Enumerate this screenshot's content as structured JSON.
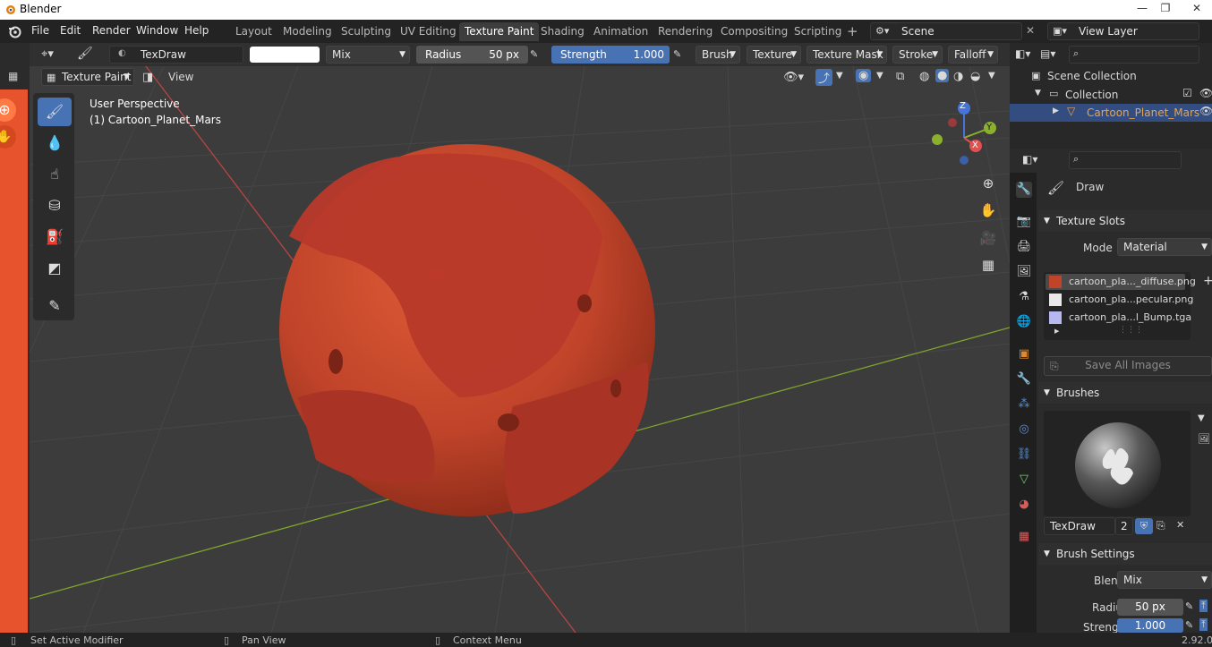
{
  "window": {
    "title": "Blender",
    "minimize": "—",
    "maximize": "❐",
    "close": "✕"
  },
  "menus": [
    "File",
    "Edit",
    "Render",
    "Window",
    "Help"
  ],
  "workspaces": [
    "Layout",
    "Modeling",
    "Sculpting",
    "UV Editing",
    "Texture Paint",
    "Shading",
    "Animation",
    "Rendering",
    "Compositing",
    "Scripting"
  ],
  "active_workspace": "Texture Paint",
  "add_workspace": "+",
  "scene": {
    "name": "Scene"
  },
  "view_layer": {
    "name": "View Layer"
  },
  "tool_header": {
    "brush_name": "TexDraw",
    "blend": "Mix",
    "radius_label": "Radius",
    "radius_value": "50 px",
    "strength_label": "Strength",
    "strength_value": "1.000",
    "strength_fraction": 1.0,
    "dropdowns": [
      "Brush",
      "Texture",
      "Texture Mask",
      "Stroke",
      "Falloff"
    ]
  },
  "viewport_header": {
    "mode": "Texture Paint",
    "view": "View"
  },
  "viewport": {
    "perspective": "User Perspective",
    "object": "(1) Cartoon_Planet_Mars",
    "gizmo_axes": {
      "z": "Z",
      "y": "Y",
      "x": "X"
    }
  },
  "outliner": {
    "scene_collection": "Scene Collection",
    "collection": "Collection",
    "object": "Cartoon_Planet_Mars"
  },
  "properties": {
    "tool_name": "Draw",
    "texture_slots": {
      "title": "Texture Slots",
      "mode_label": "Mode",
      "mode_value": "Material",
      "slots": [
        {
          "name": "cartoon_pla..._diffuse.png",
          "color": "#c0442a"
        },
        {
          "name": "cartoon_pla...pecular.png",
          "color": "#e8e8e8"
        },
        {
          "name": "cartoon_pla...l_Bump.tga",
          "color": "#b8b8f0"
        }
      ],
      "save_all": "Save All Images"
    },
    "brushes": {
      "title": "Brushes",
      "brush": "TexDraw",
      "users": "2"
    },
    "brush_settings": {
      "title": "Brush Settings",
      "blend_label": "Blend",
      "blend_value": "Mix",
      "radius_label": "Radius",
      "radius_value": "50 px",
      "strength_label": "Strength",
      "strength_value": "1.000"
    }
  },
  "status_bar": {
    "left": "Set Active Modifier",
    "middle": "Pan View",
    "right": "Context Menu",
    "version": "2.92.0"
  },
  "colors": {
    "accent": "#4772b3",
    "active_object": "#e8a44a",
    "mars": "#c0442a"
  }
}
